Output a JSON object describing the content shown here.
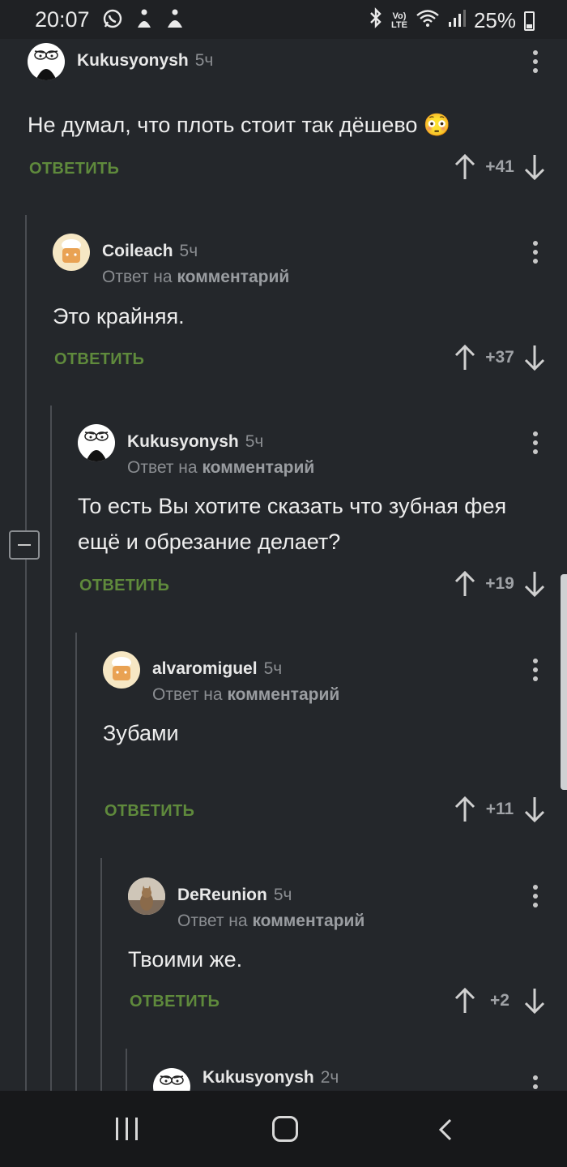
{
  "status_bar": {
    "time": "20:07",
    "battery": "25%",
    "network": "Vo)) LTE",
    "icons": [
      "whatsapp-icon",
      "notification-icon",
      "notification-icon",
      "bluetooth-icon",
      "wifi-icon",
      "signal-icon",
      "battery-icon"
    ]
  },
  "comments": [
    {
      "author": "Kukusyonysh",
      "time": "5ч",
      "reply_to_prefix": "",
      "reply_to_target": "",
      "text": "Не думал, что плоть стоит так дёшево 😳",
      "reply_label": "ОТВЕТИТЬ",
      "score": "+41",
      "avatar": "rage-face-avatar"
    },
    {
      "author": "Coileach",
      "time": "5ч",
      "reply_to_prefix": "Ответ на",
      "reply_to_target": "комментарий",
      "text": "Это крайняя.",
      "reply_label": "ОТВЕТИТЬ",
      "score": "+37",
      "avatar": "default-avatar"
    },
    {
      "author": "Kukusyonysh",
      "time": "5ч",
      "reply_to_prefix": "Ответ на",
      "reply_to_target": "комментарий",
      "text": "То есть Вы хотите сказать что зубная фея ещё и обрезание делает?",
      "reply_label": "ОТВЕТИТЬ",
      "score": "+19",
      "avatar": "rage-face-avatar"
    },
    {
      "author": "alvaromiguel",
      "time": "5ч",
      "reply_to_prefix": "Ответ на",
      "reply_to_target": "комментарий",
      "text": "Зубами",
      "reply_label": "ОТВЕТИТЬ",
      "score": "+11",
      "avatar": "default-avatar"
    },
    {
      "author": "DeReunion",
      "time": "5ч",
      "reply_to_prefix": "Ответ на",
      "reply_to_target": "комментарий",
      "text": "Твоими же.",
      "reply_label": "ОТВЕТИТЬ",
      "score": "+2",
      "avatar": "cat-photo-avatar"
    },
    {
      "author": "Kukusyonysh",
      "time": "2ч",
      "reply_to_prefix": "",
      "reply_to_target": "",
      "text": "",
      "reply_label": "",
      "score": "",
      "avatar": "rage-face-avatar"
    }
  ],
  "colors": {
    "background": "#24272b",
    "reply_green": "#5f8a3c",
    "muted": "#8a8d91"
  }
}
